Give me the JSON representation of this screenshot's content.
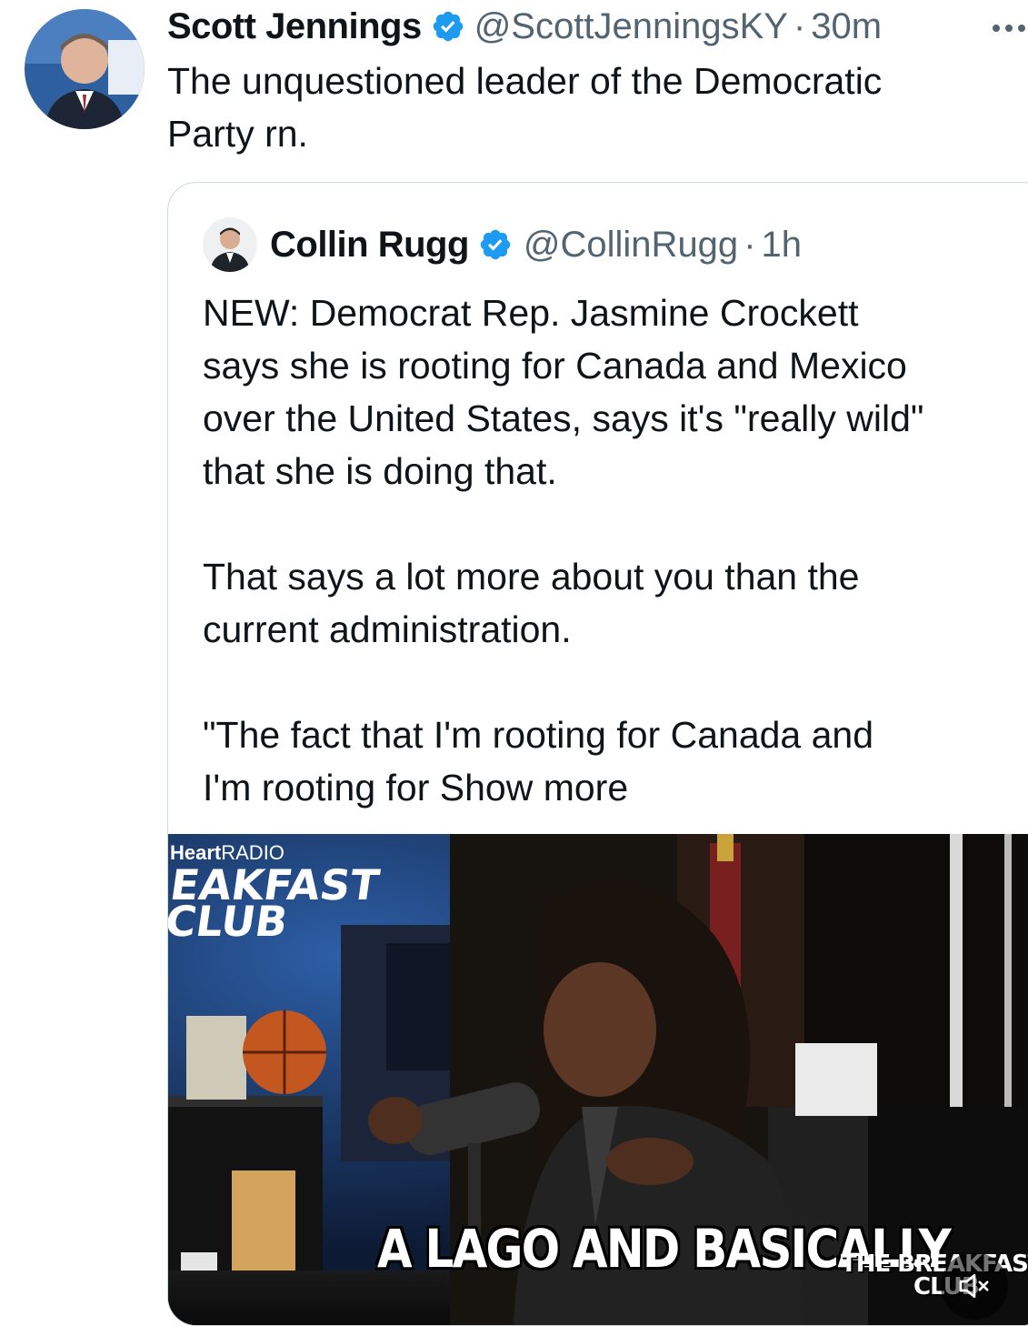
{
  "tweet": {
    "display_name": "Scott Jennings",
    "handle": "@ScottJenningsKY",
    "separator": "·",
    "time": "30m",
    "text": "The unquestioned leader of the Democratic\nParty rn.",
    "avatar_icon": "person-avatar-icon",
    "more_icon": "ellipsis-icon",
    "verified_icon": "verified-badge-icon",
    "verified_color": "#1d9bf0"
  },
  "quote": {
    "display_name": "Collin Rugg",
    "handle": "@CollinRugg",
    "separator": "·",
    "time": "1h",
    "text": "NEW: Democrat Rep. Jasmine Crockett\nsays she is rooting for Canada and Mexico\nover the United States, says it's \"really wild\"\nthat she is doing that.\n\nThat says a lot more about you than the\ncurrent administration.\n\n\"The fact that I'm rooting for Canada and\nI'm rooting for ",
    "show_more": "Show more",
    "video": {
      "brand_top": "Heart",
      "brand_radio": "RADIO",
      "brand_logo_line1": "EAKFAST",
      "brand_logo_line2": "CLUB",
      "caption": "A LAGO AND BASICALLY",
      "watermark_line1": "THE BREAKFAST",
      "watermark_line2": "CLUB",
      "mute_icon": "speaker-muted-icon"
    }
  }
}
